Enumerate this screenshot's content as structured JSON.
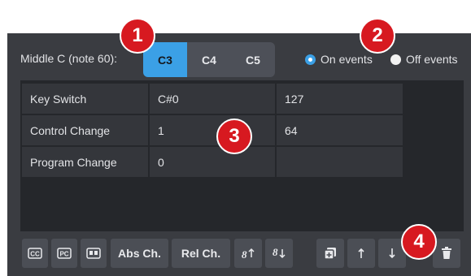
{
  "middle_c": {
    "label": "Middle C (note 60):",
    "options": [
      "C3",
      "C4",
      "C5"
    ],
    "selected": "C3"
  },
  "event_mode": {
    "on_label": "On events",
    "off_label": "Off events",
    "selected": "On events"
  },
  "table": {
    "rows": [
      [
        "Key Switch",
        "C#0",
        "127"
      ],
      [
        "Control Change",
        "1",
        "64"
      ],
      [
        "Program Change",
        "0",
        ""
      ]
    ]
  },
  "toolbar": {
    "cc_icon": "cc-icon",
    "pc_icon": "pc-icon",
    "keyswitch_icon": "keyswitch-icon",
    "abs_ch": "Abs Ch.",
    "rel_ch": "Rel Ch.",
    "octave_up_icon": "octave-up-icon",
    "octave_down_icon": "octave-down-icon",
    "duplicate_icon": "duplicate-icon",
    "move_up_icon": "move-up-icon",
    "move_down_icon": "move-down-icon",
    "delete_icon": "trash-icon"
  },
  "callouts": [
    "1",
    "2",
    "3",
    "4"
  ],
  "colors": {
    "accent": "#3ba0e6",
    "panel": "#3a3c41",
    "callout": "#d71920"
  }
}
